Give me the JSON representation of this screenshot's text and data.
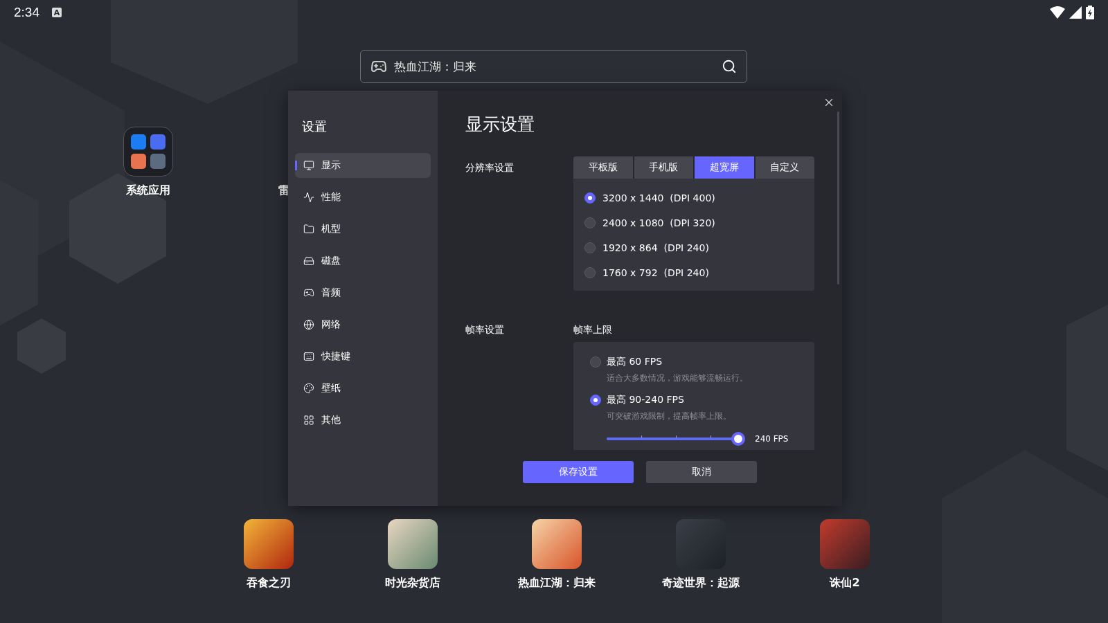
{
  "status_bar": {
    "time": "2:34",
    "notification_badge": "A"
  },
  "search": {
    "value": "热血江湖：归来"
  },
  "desktop_apps": [
    {
      "label": "系统应用"
    },
    {
      "label": "雷"
    }
  ],
  "dialog": {
    "sidebar_title": "设置",
    "nav": [
      {
        "label": "显示",
        "selected": true
      },
      {
        "label": "性能",
        "selected": false
      },
      {
        "label": "机型",
        "selected": false
      },
      {
        "label": "磁盘",
        "selected": false
      },
      {
        "label": "音频",
        "selected": false
      },
      {
        "label": "网络",
        "selected": false
      },
      {
        "label": "快捷键",
        "selected": false
      },
      {
        "label": "壁纸",
        "selected": false
      },
      {
        "label": "其他",
        "selected": false
      }
    ],
    "title": "显示设置",
    "resolution": {
      "label": "分辨率设置",
      "tabs": [
        {
          "label": "平板版",
          "selected": false
        },
        {
          "label": "手机版",
          "selected": false
        },
        {
          "label": "超宽屏",
          "selected": true
        },
        {
          "label": "自定义",
          "selected": false
        }
      ],
      "options": [
        {
          "label": "3200 x 1440  (DPI 400)",
          "selected": true
        },
        {
          "label": "2400 x 1080  (DPI 320)",
          "selected": false
        },
        {
          "label": "1920 x 864  (DPI 240)",
          "selected": false
        },
        {
          "label": "1760 x 792  (DPI 240)",
          "selected": false
        }
      ]
    },
    "frame_rate": {
      "label": "帧率设置",
      "sublabel": "帧率上限",
      "options": [
        {
          "label": "最高 60 FPS",
          "description": "适合大多数情况，游戏能够流畅运行。",
          "selected": false
        },
        {
          "label": "最高 90-240 FPS",
          "description": "可突破游戏限制，提高帧率上限。",
          "selected": true
        }
      ],
      "slider": {
        "level": 1,
        "reading": "240 FPS"
      }
    },
    "buttons": [
      {
        "label": "保存设置",
        "kind": "primary"
      },
      {
        "label": "取消",
        "kind": "secondary"
      }
    ]
  },
  "dock": [
    {
      "label": "吞食之刃"
    },
    {
      "label": "时光杂货店"
    },
    {
      "label": "热血江湖：归来"
    },
    {
      "label": "奇迹世界：起源"
    },
    {
      "label": "诛仙2"
    }
  ]
}
